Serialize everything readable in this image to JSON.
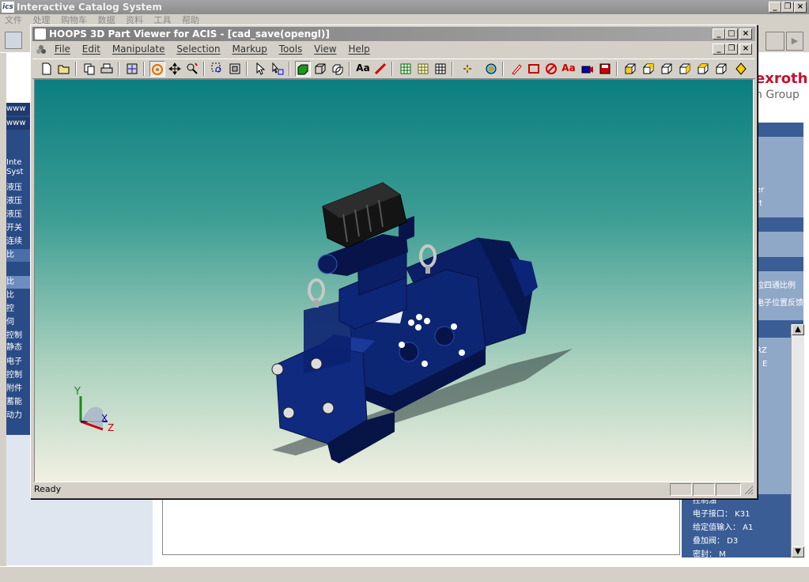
{
  "background_app": {
    "title": "Interactive Catalog System",
    "logo_text": "ics",
    "menu": [
      "文件",
      "处理",
      "购物车",
      "数据",
      "资料",
      "工具",
      "帮助"
    ],
    "brand": {
      "name": "exroth",
      "sub": "h Group",
      "color": "#c8102e"
    },
    "left_nav": [
      "www",
      "www",
      "Inte",
      "Syst",
      "液压",
      "液压",
      "液压",
      "开关",
      "连续",
      "比",
      "",
      "比",
      "比",
      "控",
      "伺",
      "控制",
      "静态",
      "电子",
      "控制",
      "附件",
      "蓄能",
      "动力"
    ],
    "right_panel_text": [
      "er",
      "rt",
      "拉四通比例",
      "电子位置反馈",
      "RZ",
      "E"
    ],
    "right_list": [
      "控制油",
      "电子接口： K31",
      "给定值输入： A1",
      "叠加阀： D3",
      "密封： M"
    ]
  },
  "viewer": {
    "title": "HOOPS 3D Part Viewer for ACIS - [cad_save(opengl)]",
    "menu": [
      "File",
      "Edit",
      "Manipulate",
      "Selection",
      "Markup",
      "Tools",
      "View",
      "Help"
    ],
    "status": "Ready",
    "toolbar_icons": [
      "new-icon",
      "open-icon",
      "copy-icon",
      "print-icon",
      "fit-icon",
      "orbit-icon",
      "pan-icon",
      "zoom-icon",
      "zoom-window-icon",
      "zoom-extents-icon",
      "select-icon",
      "select-area-icon",
      "shaded-icon",
      "wireframe-icon",
      "hidden-line-icon",
      "text-icon",
      "measure-icon",
      "grid1-icon",
      "grid2-icon",
      "grid3-icon",
      "center-icon",
      "camera-icon",
      "markup-pen-icon",
      "markup-rect-icon",
      "markup-erase-icon",
      "markup-text-icon",
      "markup-camera-icon",
      "markup-save-icon",
      "view-iso-icon",
      "view-front-icon",
      "view-back-icon",
      "view-left-icon",
      "view-right-icon",
      "view-top-icon",
      "light-icon"
    ],
    "axis": {
      "x": "X",
      "y": "Y",
      "z": "Z"
    },
    "colors": {
      "part": "#0a1f66",
      "bg_top": "#0b7e80",
      "bg_bottom": "#f1f0e2"
    }
  }
}
